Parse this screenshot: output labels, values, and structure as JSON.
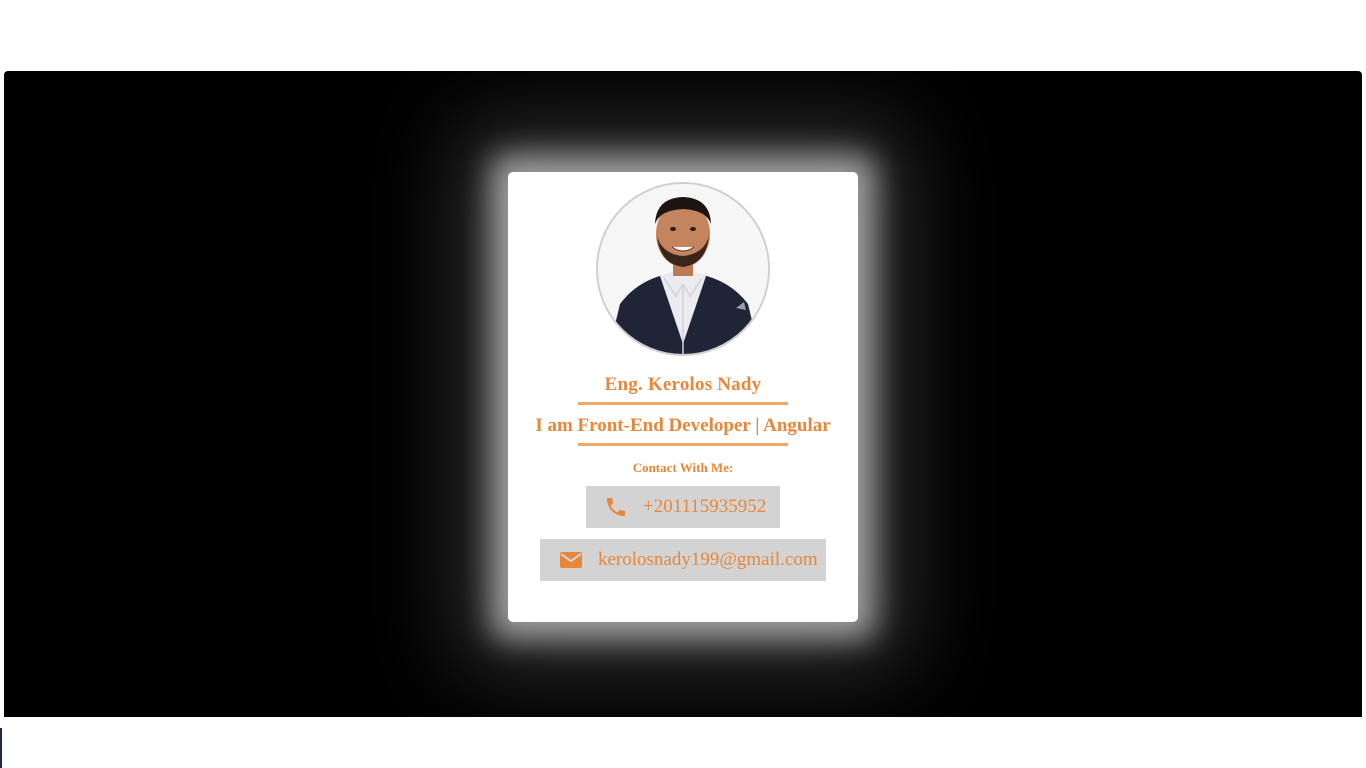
{
  "profile": {
    "name": "Eng. Kerolos Nady",
    "role": "I am Front-End Developer | Angular",
    "contact_label": "Contact With Me:"
  },
  "contacts": {
    "phone": {
      "icon": "phone-icon",
      "value": "+201115935952"
    },
    "email": {
      "icon": "envelope-icon",
      "value": "kerolosnady199@gmail.com"
    }
  },
  "colors": {
    "accent": "#e8873a",
    "stage_background": "#000000",
    "card_background": "#ffffff",
    "pill_background": "#d3d3d3"
  }
}
